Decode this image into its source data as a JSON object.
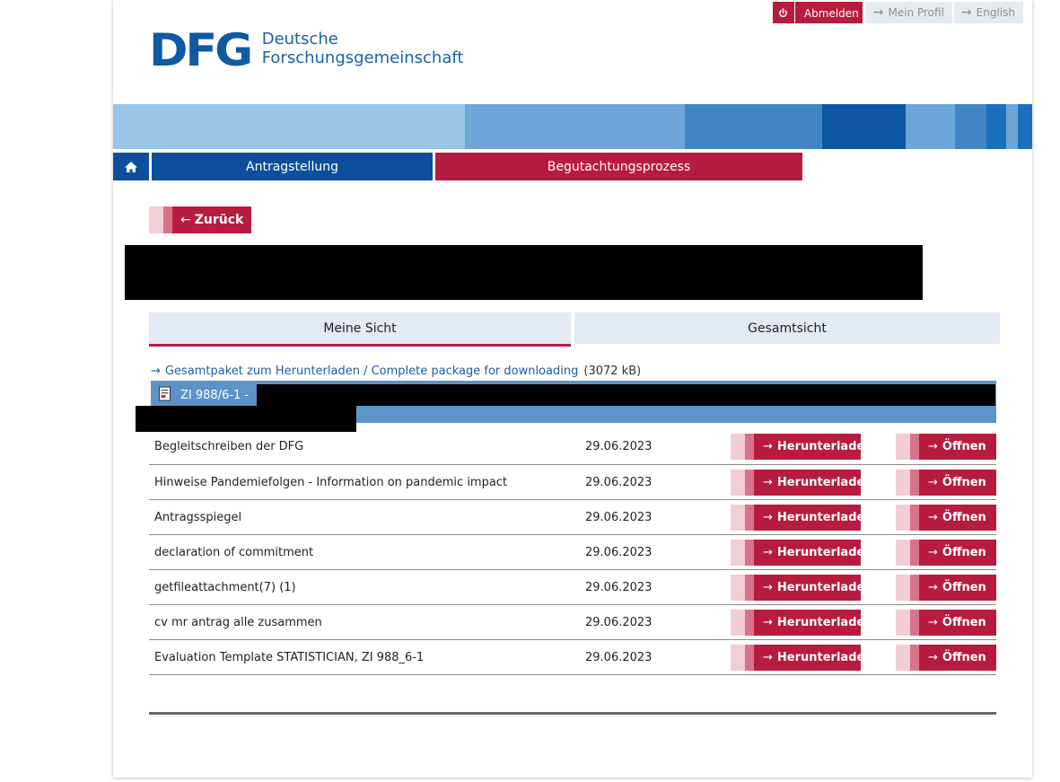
{
  "topbar": {
    "logout_label": "Abmelden",
    "profile_label": "Mein Profil",
    "language_label": "English"
  },
  "logo": {
    "mark": "DFG",
    "line1": "Deutsche",
    "line2": "Forschungsgemeinschaft"
  },
  "colors": {
    "brand_blue": "#0d4f9c",
    "brand_red": "#b71b3e",
    "group_bar": "#5d93c6",
    "stripe": [
      "#98c6e8",
      "#6ea6d7",
      "#4386c5",
      "#0d56a3",
      "#6ea6d7",
      "#4386c5",
      "#1a70bd",
      "#6ea6d7",
      "#1a70bd"
    ]
  },
  "nav": {
    "home_icon": "home-icon",
    "items": [
      {
        "label": "Antragstellung"
      },
      {
        "label": "Begutachtungsprozess"
      }
    ]
  },
  "back_label": "Zurück",
  "tabs": [
    {
      "label": "Meine Sicht",
      "active": true
    },
    {
      "label": "Gesamtsicht",
      "active": false
    }
  ],
  "package": {
    "link_label": "Gesamtpaket zum Herunterladen / Complete package for downloading",
    "size": "(3072 kB)"
  },
  "group": {
    "title": "ZI 988/6-1 -",
    "icon": "pdf-document-icon"
  },
  "documents": [
    {
      "name": "Begleitschreiben der DFG",
      "date": "29.06.2023"
    },
    {
      "name": "Hinweise Pandemiefolgen - Information on pandemic impact",
      "date": "29.06.2023"
    },
    {
      "name": "Antragsspiegel",
      "date": "29.06.2023"
    },
    {
      "name": "declaration of commitment",
      "date": "29.06.2023"
    },
    {
      "name": "getfileattachment(7) (1)",
      "date": "29.06.2023"
    },
    {
      "name": "cv mr antrag alle zusammen",
      "date": "29.06.2023"
    },
    {
      "name": "Evaluation Template STATISTICIAN, ZI 988_6-1",
      "date": "29.06.2023"
    }
  ],
  "buttons": {
    "download_label": "Herunterladen",
    "open_label": "Öffnen"
  }
}
